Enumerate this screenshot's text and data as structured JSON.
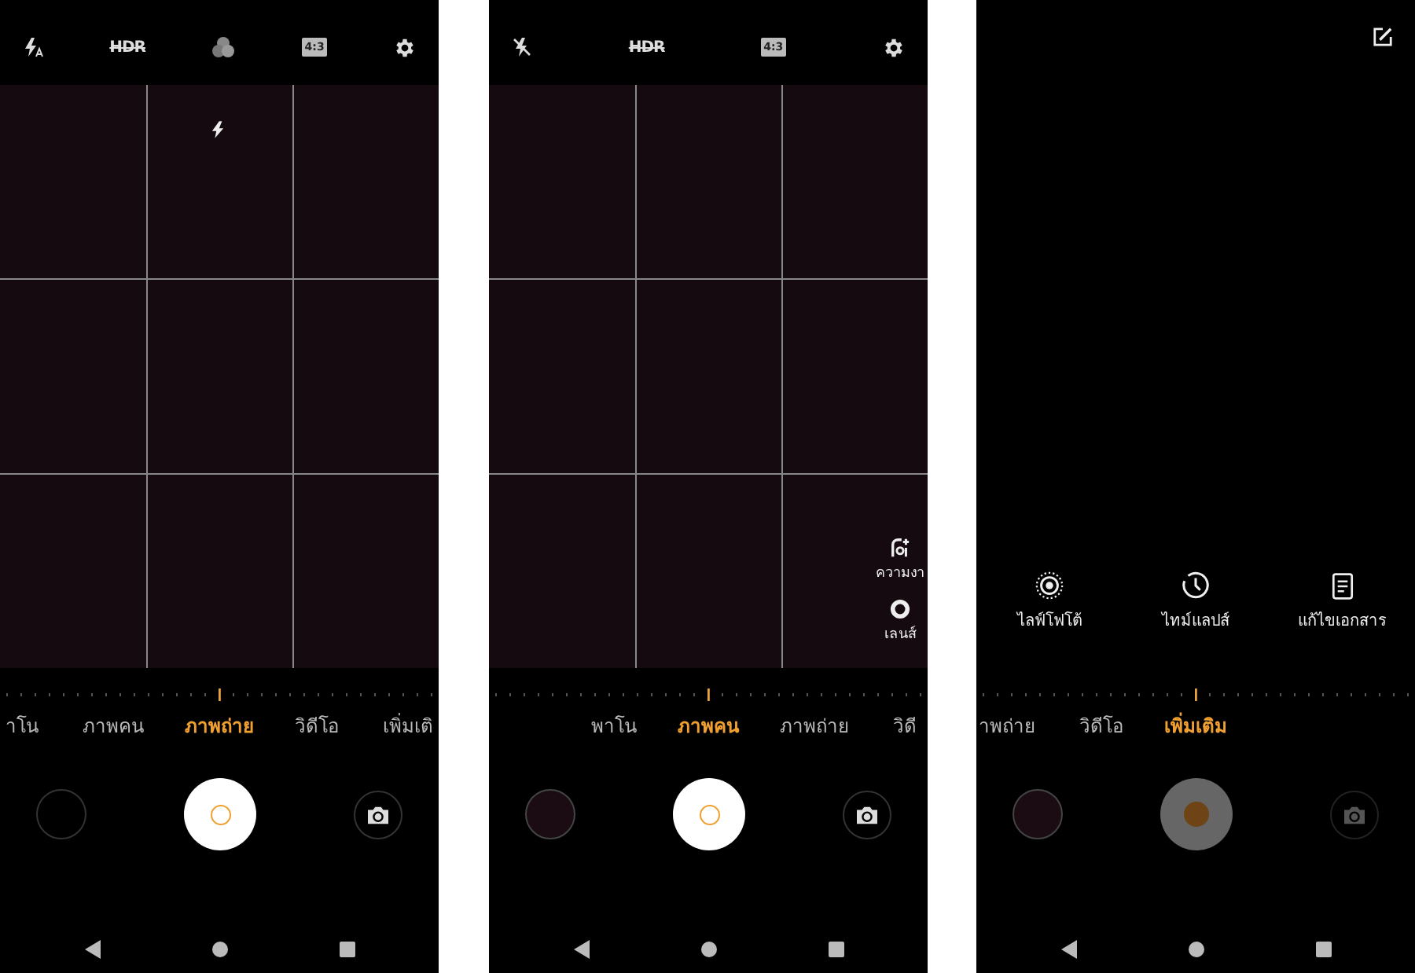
{
  "screens": [
    {
      "top_icons": [
        {
          "kind": "flash_auto"
        },
        {
          "kind": "hdr",
          "text": "HDR"
        },
        {
          "kind": "filter"
        },
        {
          "kind": "ratio",
          "text": "4:3"
        },
        {
          "kind": "settings"
        }
      ],
      "viewfinder": {
        "flash_indicator": true
      },
      "modes": [
        {
          "label": "าโน",
          "selected": false
        },
        {
          "label": "ภาพคน",
          "selected": false
        },
        {
          "label": "ภาพถ่าย",
          "selected": true
        },
        {
          "label": "วิดีโอ",
          "selected": false
        },
        {
          "label": "เพิ่มเติ",
          "selected": false
        }
      ],
      "shutter": {
        "enabled": true
      }
    },
    {
      "top_icons": [
        {
          "kind": "flash_off"
        },
        {
          "kind": "hdr",
          "text": "HDR"
        },
        {
          "kind": "ratio",
          "text": "4:3"
        },
        {
          "kind": "settings"
        }
      ],
      "viewfinder": {
        "side_controls": [
          {
            "kind": "beauty",
            "label": "ความงา"
          },
          {
            "kind": "lens",
            "label": "เลนส์"
          }
        ]
      },
      "modes": [
        {
          "label": "พาโน",
          "selected": false
        },
        {
          "label": "ภาพคน",
          "selected": true
        },
        {
          "label": "ภาพถ่าย",
          "selected": false
        },
        {
          "label": "วิดี",
          "selected": false
        }
      ],
      "shutter": {
        "enabled": true
      }
    },
    {
      "top_icons": [
        {
          "kind": "edit"
        }
      ],
      "more_options": [
        {
          "kind": "live_photo",
          "label": "ไลฟ์โฟโต้"
        },
        {
          "kind": "timelapse",
          "label": "ไทม์แลปส์"
        },
        {
          "kind": "document",
          "label": "แก้ไขเอกสาร"
        }
      ],
      "modes": [
        {
          "label": "าพถ่าย",
          "selected": false
        },
        {
          "label": "วิดีโอ",
          "selected": false
        },
        {
          "label": "เพิ่มเติม",
          "selected": true
        }
      ],
      "shutter": {
        "enabled": false
      }
    }
  ]
}
